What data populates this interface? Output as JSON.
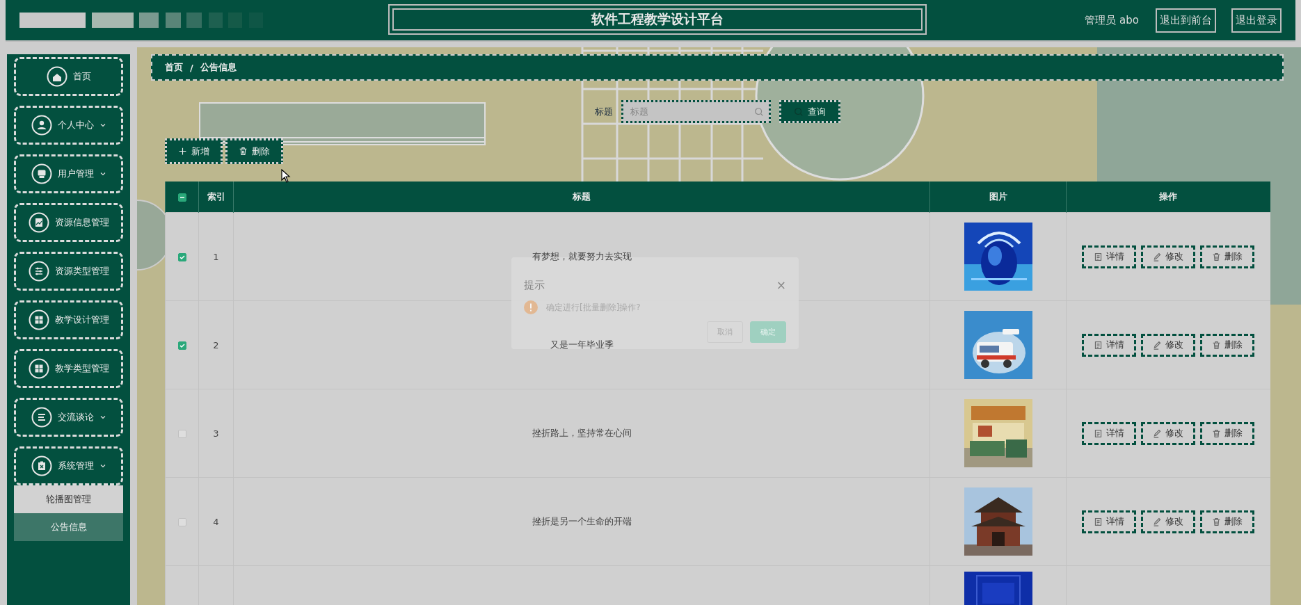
{
  "header": {
    "title": "软件工程教学设计平台",
    "user": "管理员 abo",
    "links": [
      "退出到前台",
      "退出登录"
    ]
  },
  "sidebar": {
    "items": [
      {
        "kind": "link",
        "label": "首页"
      },
      {
        "kind": "group",
        "label": "个人中心"
      },
      {
        "kind": "group",
        "label": "用户管理"
      },
      {
        "kind": "link",
        "label": "资源信息管理"
      },
      {
        "kind": "link",
        "label": "资源类型管理"
      },
      {
        "kind": "link",
        "label": "教学设计管理"
      },
      {
        "kind": "link",
        "label": "教学类型管理"
      },
      {
        "kind": "group",
        "label": "交流谈论"
      },
      {
        "kind": "group",
        "label": "系统管理",
        "children": [
          {
            "label": "轮播图管理",
            "selected": false
          },
          {
            "label": "公告信息",
            "selected": true
          }
        ]
      }
    ]
  },
  "breadcrumb": {
    "items": [
      "首页",
      "公告信息"
    ],
    "separator": "/"
  },
  "search": {
    "label": "标题",
    "placeholder": "标题",
    "button": "查询"
  },
  "toolbar": [
    {
      "kind": "add",
      "label": "新增"
    },
    {
      "kind": "delete",
      "label": "删除"
    }
  ],
  "table": {
    "select_all": {
      "checked": false,
      "indeterminate": true
    },
    "columns": [
      "索引",
      "标题",
      "图片",
      "操作"
    ],
    "rows": [
      {
        "checked": true,
        "index": "1",
        "title": "有梦想，就要努力去实现",
        "image": {
          "kind": "picture"
        },
        "actions": [
          "详情",
          "修改",
          "删除"
        ]
      },
      {
        "checked": true,
        "index": "2",
        "title": "又是一年毕业季",
        "image": {
          "kind": "picture"
        },
        "actions": [
          "详情",
          "修改",
          "删除"
        ]
      },
      {
        "checked": false,
        "index": "3",
        "title": "挫折路上，坚持常在心间",
        "image": {
          "kind": "picture"
        },
        "actions": [
          "详情",
          "修改",
          "删除"
        ]
      },
      {
        "checked": false,
        "index": "4",
        "title": "挫折是另一个生命的开端",
        "image": {
          "kind": "picture"
        },
        "actions": [
          "详情",
          "修改",
          "删除"
        ]
      },
      {
        "image": {
          "kind": "picture"
        }
      }
    ]
  },
  "dialog": {
    "title": "提示",
    "close": "×",
    "message": "确定进行[批量删除]操作?",
    "buttons": [
      {
        "kind": "cancel",
        "label": "取消"
      },
      {
        "kind": "confirm",
        "label": "确定"
      }
    ]
  }
}
